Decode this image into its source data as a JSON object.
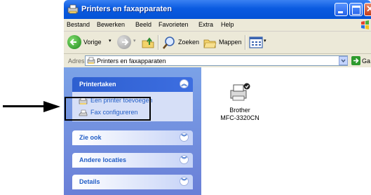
{
  "window": {
    "title": "Printers en faxapparaten",
    "colors": {
      "titlebar": "#0453d6",
      "taskpane": "#7ba2e7",
      "link": "#215dc6"
    }
  },
  "menu": [
    "Bestand",
    "Bewerken",
    "Beeld",
    "Favorieten",
    "Extra",
    "Help"
  ],
  "toolbar": {
    "back_label": "Vorige",
    "search_label": "Zoeken",
    "folders_label": "Mappen"
  },
  "address": {
    "label": "Adres",
    "value": "Printers en faxapparaten",
    "go_label": "Ga naar"
  },
  "taskpane": {
    "printer_tasks": {
      "title": "Printertaken",
      "links": [
        "Een printer toevoegen",
        "Fax configureren"
      ]
    },
    "see_also": {
      "title": "Zie ook"
    },
    "other_places": {
      "title": "Andere locaties"
    },
    "details": {
      "title": "Details"
    }
  },
  "printers": [
    {
      "name_line1": "Brother",
      "name_line2": "MFC-3320CN"
    }
  ]
}
